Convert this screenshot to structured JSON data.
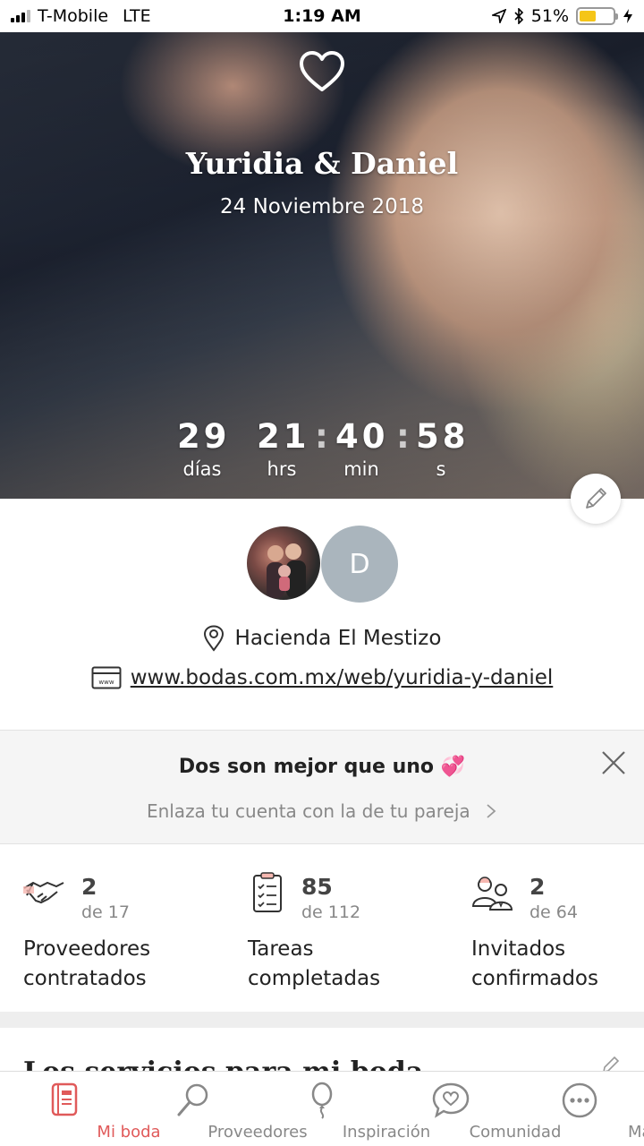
{
  "status_bar": {
    "carrier": "T-Mobile",
    "network": "LTE",
    "time": "1:19 AM",
    "battery": "51%",
    "battery_level": 0.51
  },
  "hero": {
    "couple": "Yuridia & Daniel",
    "date": "24 Noviembre 2018",
    "countdown": {
      "days": "29",
      "hours": "21",
      "minutes": "40",
      "seconds": "58",
      "days_label": "días",
      "hours_label": "hrs",
      "minutes_label": "min",
      "seconds_label": "s"
    }
  },
  "profile": {
    "partner_initial": "D",
    "venue": "Hacienda El Mestizo",
    "website": "www.bodas.com.mx/web/yuridia-y-daniel"
  },
  "promo": {
    "title": "Dos son mejor que uno 💞",
    "subtitle": "Enlaza tu cuenta con la de tu pareja"
  },
  "stats": [
    {
      "icon": "handshake-icon",
      "value": "2",
      "of": "de 17",
      "label_line1": "Proveedores",
      "label_line2": "contratados"
    },
    {
      "icon": "checklist-icon",
      "value": "85",
      "of": "de 112",
      "label_line1": "Tareas",
      "label_line2": "completadas"
    },
    {
      "icon": "guests-icon",
      "value": "2",
      "of": "de 64",
      "label_line1": "Invitados",
      "label_line2": "confirmados"
    }
  ],
  "services": {
    "title": "Los servicios para mi boda"
  },
  "tabbar": {
    "items": [
      {
        "label": "Mi boda",
        "icon": "notebook-icon",
        "active": true
      },
      {
        "label": "Proveedores",
        "icon": "search-icon",
        "active": false
      },
      {
        "label": "Inspiración",
        "icon": "balloon-icon",
        "active": false
      },
      {
        "label": "Comunidad",
        "icon": "chat-heart-icon",
        "active": false
      },
      {
        "label": "Más",
        "icon": "more-icon",
        "active": false
      }
    ]
  },
  "colors": {
    "accent": "#e05a5a",
    "battery": "#f5c518",
    "avatar_placeholder": "#aab5bd"
  }
}
